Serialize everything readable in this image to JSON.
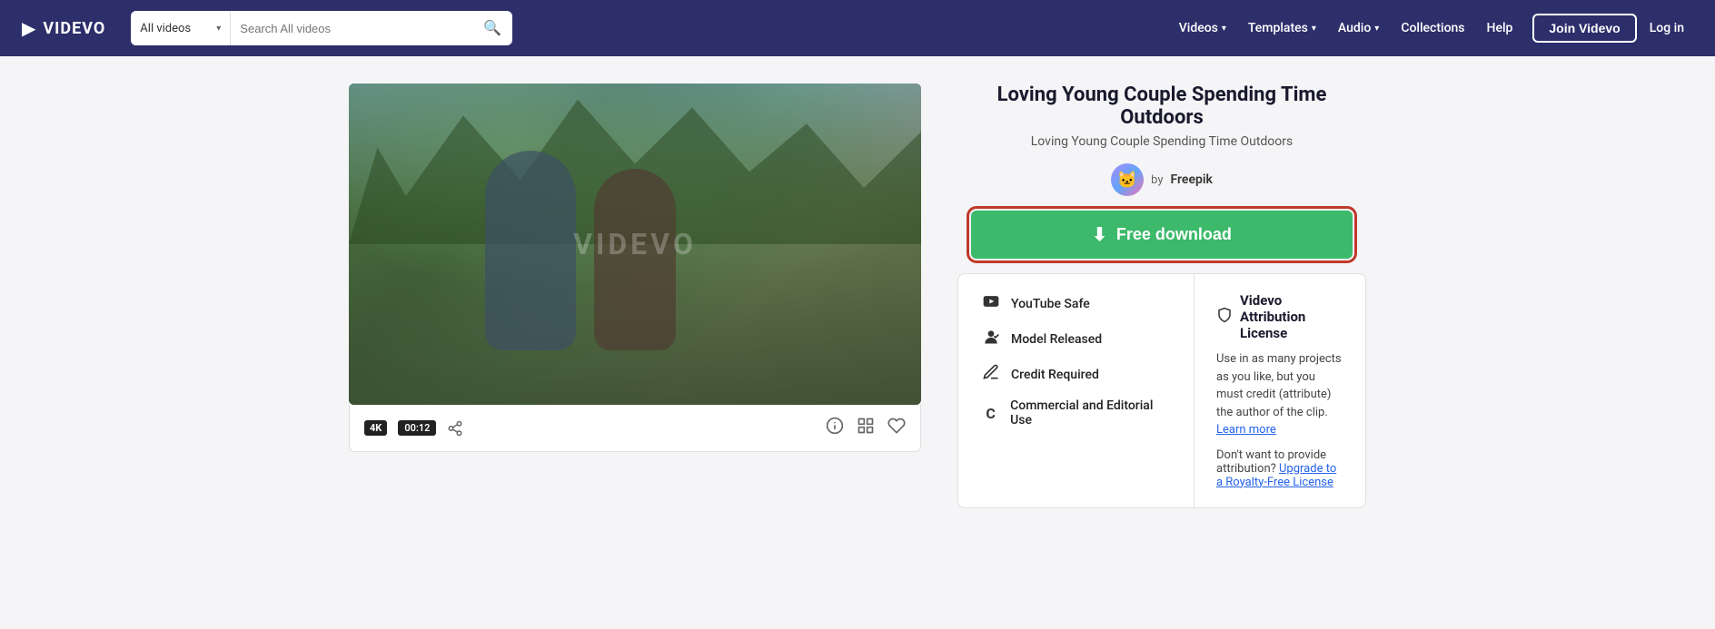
{
  "navbar": {
    "logo_text": "VIDEVO",
    "logo_icon": "▶",
    "search_dropdown_label": "All videos",
    "search_placeholder": "Search All videos",
    "search_chevron": "▾",
    "nav_items": [
      {
        "label": "Videos",
        "has_dropdown": true
      },
      {
        "label": "Templates",
        "has_dropdown": true
      },
      {
        "label": "Audio",
        "has_dropdown": true
      },
      {
        "label": "Collections",
        "has_dropdown": false
      },
      {
        "label": "Help",
        "has_dropdown": false
      }
    ],
    "join_label": "Join Videvo",
    "login_label": "Log in"
  },
  "video": {
    "title": "Loving Young Couple Spending Time Outdoors",
    "subtitle": "Loving Young Couple Spending Time Outdoors",
    "author_prefix": "by",
    "author_name": "Freepik",
    "watermark": "VIDEVO",
    "badge_4k": "4K",
    "timestamp": "00:12"
  },
  "download": {
    "icon": "⬇",
    "label": "Free download",
    "outline_color": "#c0392b"
  },
  "attributes": [
    {
      "icon": "▶",
      "label": "YouTube Safe"
    },
    {
      "icon": "👤",
      "label": "Model Released"
    },
    {
      "icon": "✏",
      "label": "Credit Required"
    },
    {
      "icon": "©",
      "label": "Commercial and Editorial Use"
    }
  ],
  "license": {
    "icon": "🔖",
    "title": "Videvo Attribution License",
    "description": "Use in as many projects as you like, but you must credit (attribute) the author of the clip.",
    "learn_more_label": "Learn more",
    "no_attribution_text": "Don't want to provide attribution?",
    "upgrade_label": "Upgrade to a Royalty-Free License"
  },
  "controls": {
    "info_icon": "ℹ",
    "add_icon": "⊞",
    "heart_icon": "♡"
  }
}
